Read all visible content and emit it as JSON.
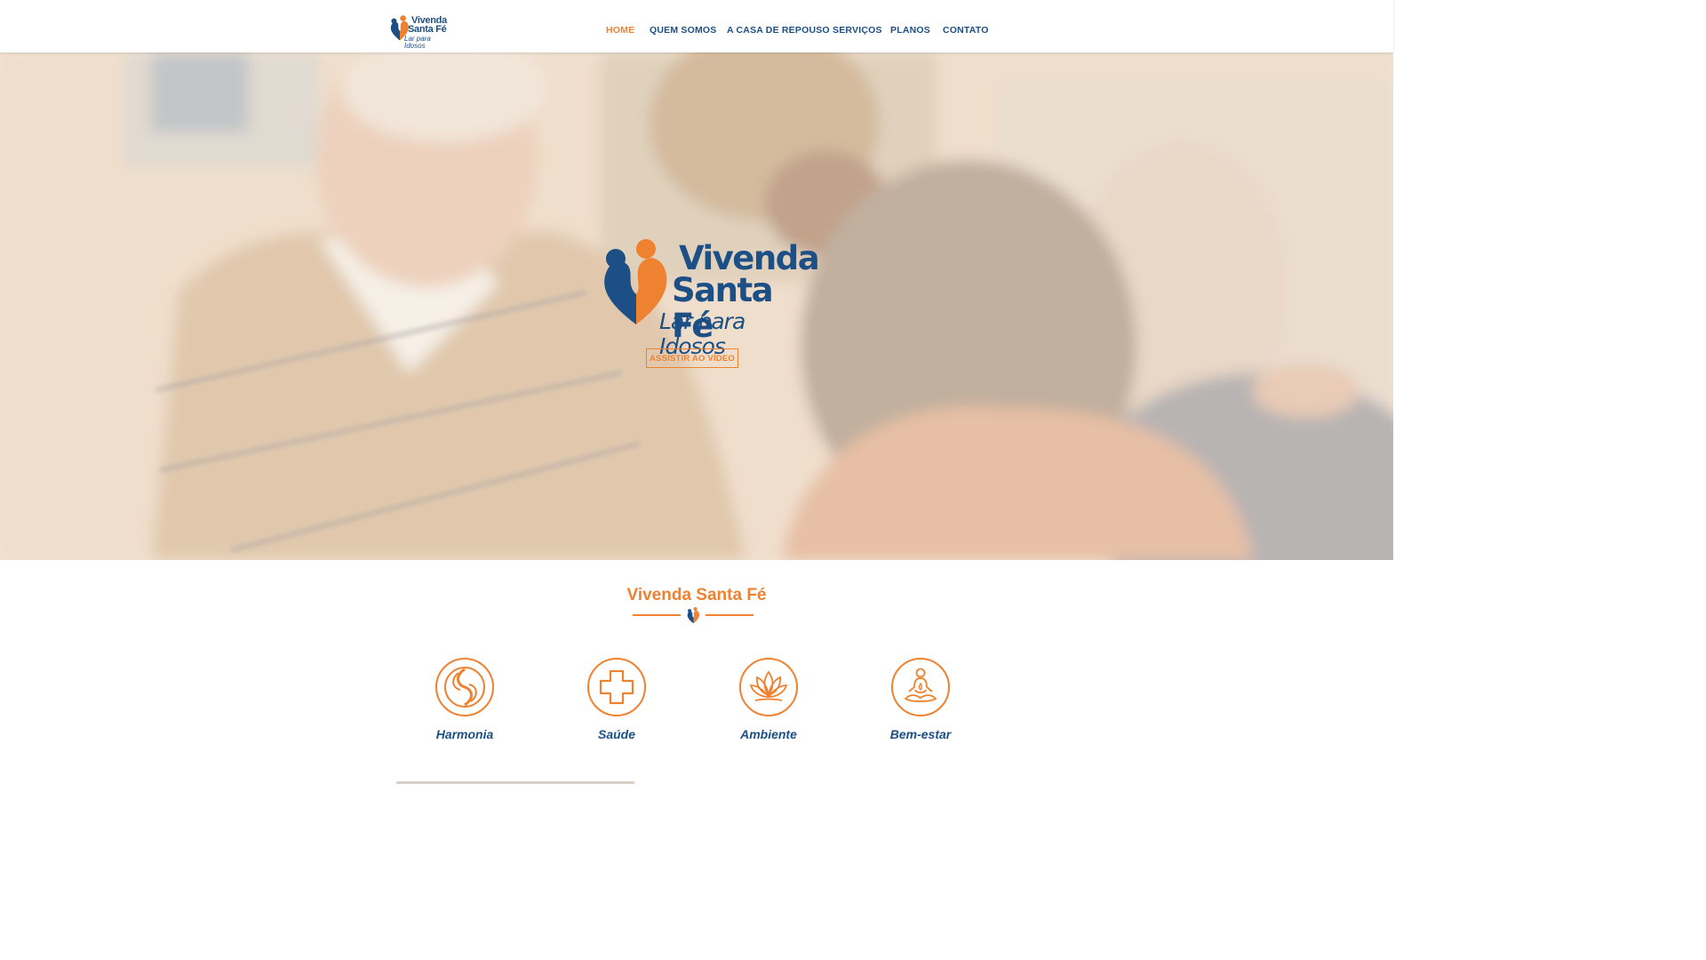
{
  "header": {
    "logo": {
      "line1": "Vivenda",
      "line2": "Santa Fé",
      "line3": "Lar para Idosos"
    },
    "nav": [
      {
        "label": "HOME",
        "active": true
      },
      {
        "label": "QUEM SOMOS",
        "active": false
      },
      {
        "label": "A CASA DE REPOUSO",
        "active": false
      },
      {
        "label": "SERVIÇOS",
        "active": false
      },
      {
        "label": "PLANOS",
        "active": false
      },
      {
        "label": "CONTATO",
        "active": false
      }
    ]
  },
  "hero": {
    "logo": {
      "line1": "Vivenda",
      "line2": "Santa Fé",
      "line3": "Lar para Idosos"
    },
    "button_label": "ASSISTIR AO VÍDEO"
  },
  "section": {
    "title": "Vivenda Santa Fé",
    "features": [
      {
        "label": "Harmonia",
        "icon": "harmony-swirl-icon"
      },
      {
        "label": "Saúde",
        "icon": "health-cross-icon"
      },
      {
        "label": "Ambiente",
        "icon": "lotus-icon"
      },
      {
        "label": "Bem-estar",
        "icon": "meditation-icon"
      }
    ]
  },
  "colors": {
    "brand_blue": "#1c4f86",
    "brand_orange": "#ef8230"
  }
}
